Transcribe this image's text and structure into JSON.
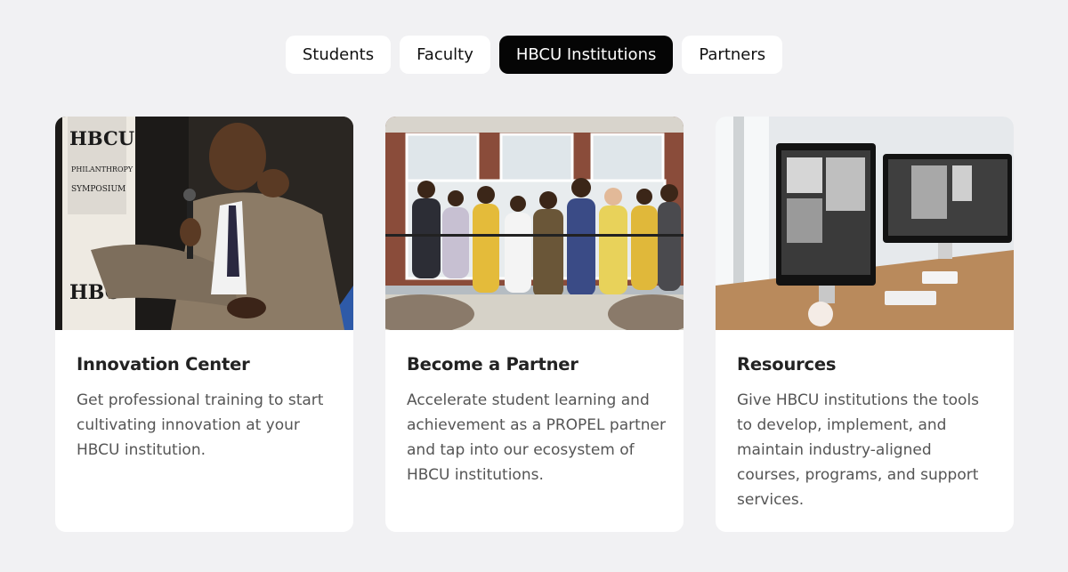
{
  "tabs": [
    {
      "label": "Students",
      "active": false
    },
    {
      "label": "Faculty",
      "active": false
    },
    {
      "label": "HBCU Institutions",
      "active": true
    },
    {
      "label": "Partners",
      "active": false
    }
  ],
  "cards": [
    {
      "title": "Innovation Center",
      "description": "Get professional training to start cultivating innovation at your HBCU institution.",
      "image": "speaker-at-hbcu-philanthropy-symposium",
      "image_banner_text": [
        "HBCU",
        "PHILANTHROPY",
        "SYMPOSIUM"
      ]
    },
    {
      "title": "Become a Partner",
      "description": "Accelerate student learning and achievement as a PROPEL partner and tap into our ecosystem of HBCU institutions.",
      "image": "group-photo-in-front-of-building"
    },
    {
      "title": "Resources",
      "description": "Give HBCU institutions the tools to develop, implement, and maintain industry-aligned courses, programs, and support services.",
      "image": "desk-with-two-monitors"
    }
  ]
}
